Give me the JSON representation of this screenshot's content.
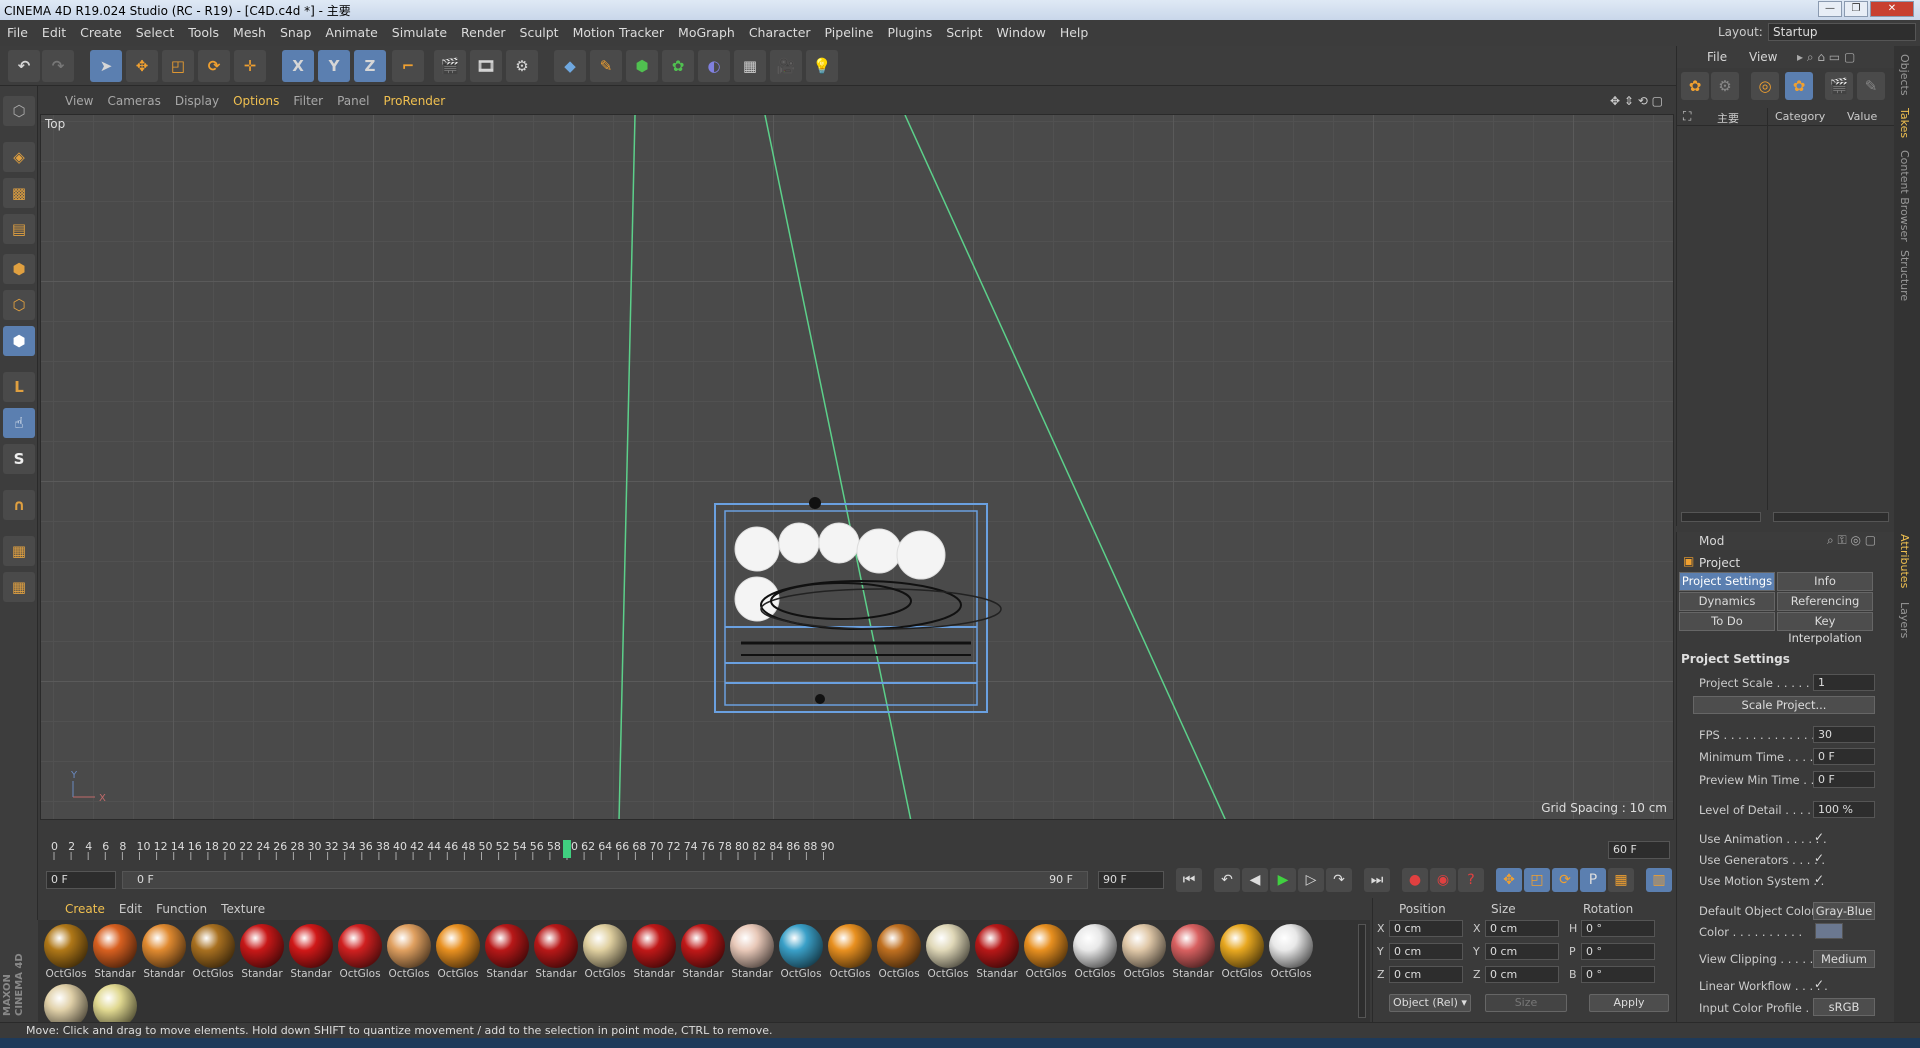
{
  "window": {
    "title": "CINEMA 4D R19.024 Studio (RC - R19) - [C4D.c4d *] - 主要",
    "buttons": [
      "—",
      "❐",
      "✕"
    ]
  },
  "menu": [
    "File",
    "Edit",
    "Create",
    "Select",
    "Tools",
    "Mesh",
    "Snap",
    "Animate",
    "Simulate",
    "Render",
    "Sculpt",
    "Motion Tracker",
    "MoGraph",
    "Character",
    "Pipeline",
    "Plugins",
    "Script",
    "Window",
    "Help"
  ],
  "layout": {
    "label": "Layout:",
    "value": "Startup"
  },
  "toolbar": {
    "x": "X",
    "y": "Y",
    "z": "Z"
  },
  "viewport": {
    "menu": [
      "View",
      "Cameras",
      "Display",
      "Options",
      "Filter",
      "Panel",
      "ProRender"
    ],
    "highlight": "Options",
    "prorender": "ProRender",
    "label": "Top",
    "grid_spacing": "Grid Spacing : 10 cm",
    "axis_y": "Y",
    "axis_x": "X"
  },
  "timeline": {
    "ticks": [
      "0",
      "2",
      "4",
      "6",
      "8",
      "10",
      "12",
      "14",
      "16",
      "18",
      "20",
      "22",
      "24",
      "26",
      "28",
      "30",
      "32",
      "34",
      "36",
      "38",
      "40",
      "42",
      "44",
      "46",
      "48",
      "50",
      "52",
      "54",
      "56",
      "58",
      "60",
      "62",
      "64",
      "66",
      "68",
      "70",
      "72",
      "74",
      "76",
      "78",
      "80",
      "82",
      "84",
      "86",
      "88",
      "90"
    ],
    "current_frame": "60",
    "frame_field": "60 F",
    "start": "0 F",
    "range_start": "0 F",
    "range_end": "90 F",
    "end": "90 F"
  },
  "materials": {
    "menu": [
      "Create",
      "Edit",
      "Function",
      "Texture"
    ],
    "highlight": "Create",
    "items": [
      {
        "label": "OctGlos",
        "color": "#b07818"
      },
      {
        "label": "Standar",
        "color": "#d86020"
      },
      {
        "label": "Standar",
        "color": "#e08a30"
      },
      {
        "label": "OctGlos",
        "color": "#a87020"
      },
      {
        "label": "Standar",
        "color": "#c81818"
      },
      {
        "label": "Standar",
        "color": "#d01818"
      },
      {
        "label": "OctGlos",
        "color": "#d02020"
      },
      {
        "label": "OctGlos",
        "color": "#e0a060"
      },
      {
        "label": "OctGlos",
        "color": "#e89020"
      },
      {
        "label": "Standar",
        "color": "#b81818"
      },
      {
        "label": "Standar",
        "color": "#b81818"
      },
      {
        "label": "OctGlos",
        "color": "#e0d0a0"
      },
      {
        "label": "Standar",
        "color": "#c01818"
      },
      {
        "label": "Standar",
        "color": "#c01818"
      },
      {
        "label": "Standar",
        "color": "#e8c8b8"
      },
      {
        "label": "OctGlos",
        "color": "#3aa0c8"
      },
      {
        "label": "OctGlos",
        "color": "#e89020"
      },
      {
        "label": "OctGlos",
        "color": "#c07020"
      },
      {
        "label": "OctGlos",
        "color": "#e0d8b8"
      },
      {
        "label": "Standar",
        "color": "#b81818"
      },
      {
        "label": "OctGlos",
        "color": "#e89020"
      },
      {
        "label": "OctGlos",
        "color": "#e8e8e8"
      },
      {
        "label": "OctGlos",
        "color": "#e0c8a8"
      },
      {
        "label": "Standar",
        "color": "#d86060"
      },
      {
        "label": "OctGlos",
        "color": "#e8a820"
      },
      {
        "label": "OctGlos",
        "color": "#e8e8e8"
      },
      {
        "label": "",
        "color": "#e0d0a8"
      },
      {
        "label": "",
        "color": "#e0d890"
      }
    ],
    "brand_top": "MAXON",
    "brand_bottom": "CINEMA 4D"
  },
  "coordinates": {
    "headers": [
      "Position",
      "Size",
      "Rotation"
    ],
    "rows": [
      {
        "pl": "X",
        "pv": "0 cm",
        "sl": "X",
        "sv": "0 cm",
        "rl": "H",
        "rv": "0 °"
      },
      {
        "pl": "Y",
        "pv": "0 cm",
        "sl": "Y",
        "sv": "0 cm",
        "rl": "P",
        "rv": "0 °"
      },
      {
        "pl": "Z",
        "pv": "0 cm",
        "sl": "Z",
        "sv": "0 cm",
        "rl": "B",
        "rv": "0 °"
      }
    ],
    "mode": "Object (Rel) ▾",
    "size_mode": "Size",
    "apply": "Apply"
  },
  "objects": {
    "menu": [
      "File",
      "View"
    ],
    "item": "主要",
    "col_category": "Category",
    "col_value": "Value"
  },
  "attributes": {
    "mode": "Mod",
    "title": "Project",
    "tabs": [
      "Project Settings",
      "Info",
      "Dynamics",
      "Referencing",
      "To Do",
      "Key Interpolation"
    ],
    "section": "Project Settings",
    "fields": [
      {
        "label": "Project Scale . . . . . . . .",
        "value": "1"
      },
      {
        "label": "FPS . . . . . . . . . . . . . . .",
        "value": "30"
      },
      {
        "label": "Minimum Time . . . . . .",
        "value": "0 F"
      },
      {
        "label": "Preview Min Time . . . .",
        "value": "0 F"
      },
      {
        "label": "Level of Detail . . . . . .",
        "value": "100 %"
      }
    ],
    "scale_button": "Scale Project...",
    "checks": [
      {
        "label": "Use Animation . . . . . .",
        "value": "✓"
      },
      {
        "label": "Use Generators . . . . .",
        "value": "✓"
      },
      {
        "label": "Use Motion System . .",
        "value": "✓"
      }
    ],
    "default_color_label": "Default Object Color",
    "default_color_value": "Gray-Blue",
    "color_label": "Color . . . . . . . . . .",
    "view_clipping_label": "View Clipping . . . . . .",
    "view_clipping_value": "Medium",
    "linear_label": "Linear Workflow . . . . .",
    "linear_value": "✓",
    "input_profile_label": "Input Color Profile . . .",
    "input_profile_value": "sRGB"
  },
  "side_tabs": [
    "Objects",
    "Takes",
    "Content Browser",
    "Structure",
    "Attributes",
    "Layers"
  ],
  "status": "Move: Click and drag to move elements. Hold down SHIFT to quantize movement / add to the selection in point mode, CTRL to remove."
}
